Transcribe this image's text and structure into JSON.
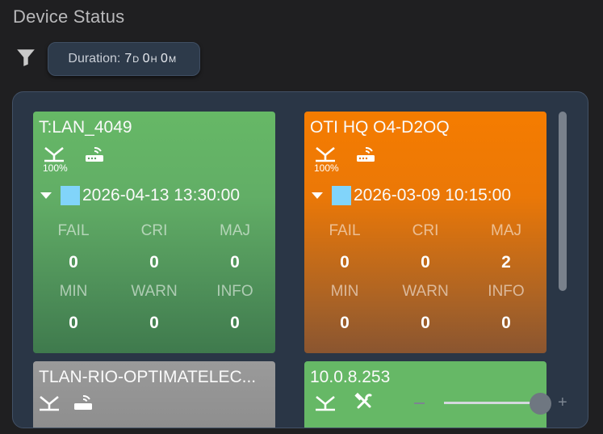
{
  "page": {
    "title": "Device Status"
  },
  "toolbar": {
    "filter_icon": "filter-icon",
    "duration": {
      "label": "Duration:",
      "days": "7",
      "days_unit": "D",
      "hours": "0",
      "hours_unit": "H",
      "minutes": "0",
      "minutes_unit": "M"
    }
  },
  "colors": {
    "green": "#66b866",
    "orange": "#f57c00",
    "gray": "#9a9a9a",
    "swatch": "#81d4fa",
    "panel": "#2a3646"
  },
  "cards": [
    {
      "title": "T:LAN_4049",
      "color": "green",
      "signal_icon": "signal-icon",
      "signal_percent": "100%",
      "router_icon": "router-icon",
      "date": "2026-04-13 13:30:00",
      "labels": [
        "FAIL",
        "CRI",
        "MAJ",
        "MIN",
        "WARN",
        "INFO"
      ],
      "counts": [
        "0",
        "0",
        "0",
        "0",
        "0",
        "0"
      ]
    },
    {
      "title": "OTI HQ O4-D2OQ",
      "color": "orange",
      "signal_icon": "signal-icon",
      "signal_percent": "100%",
      "router_icon": "router-icon",
      "date": "2026-03-09 10:15:00",
      "labels": [
        "FAIL",
        "CRI",
        "MAJ",
        "MIN",
        "WARN",
        "INFO"
      ],
      "counts": [
        "0",
        "0",
        "2",
        "0",
        "0",
        "0"
      ]
    },
    {
      "title": "TLAN-RIO-OPTIMATELEC...",
      "color": "gray",
      "signal_icon": "signal-icon",
      "router_icon": "router-icon"
    },
    {
      "title": "10.0.8.253",
      "color": "green",
      "signal_icon": "signal-icon",
      "tools_icon": "tools-icon"
    }
  ],
  "zoom": {
    "level": 0.85
  }
}
